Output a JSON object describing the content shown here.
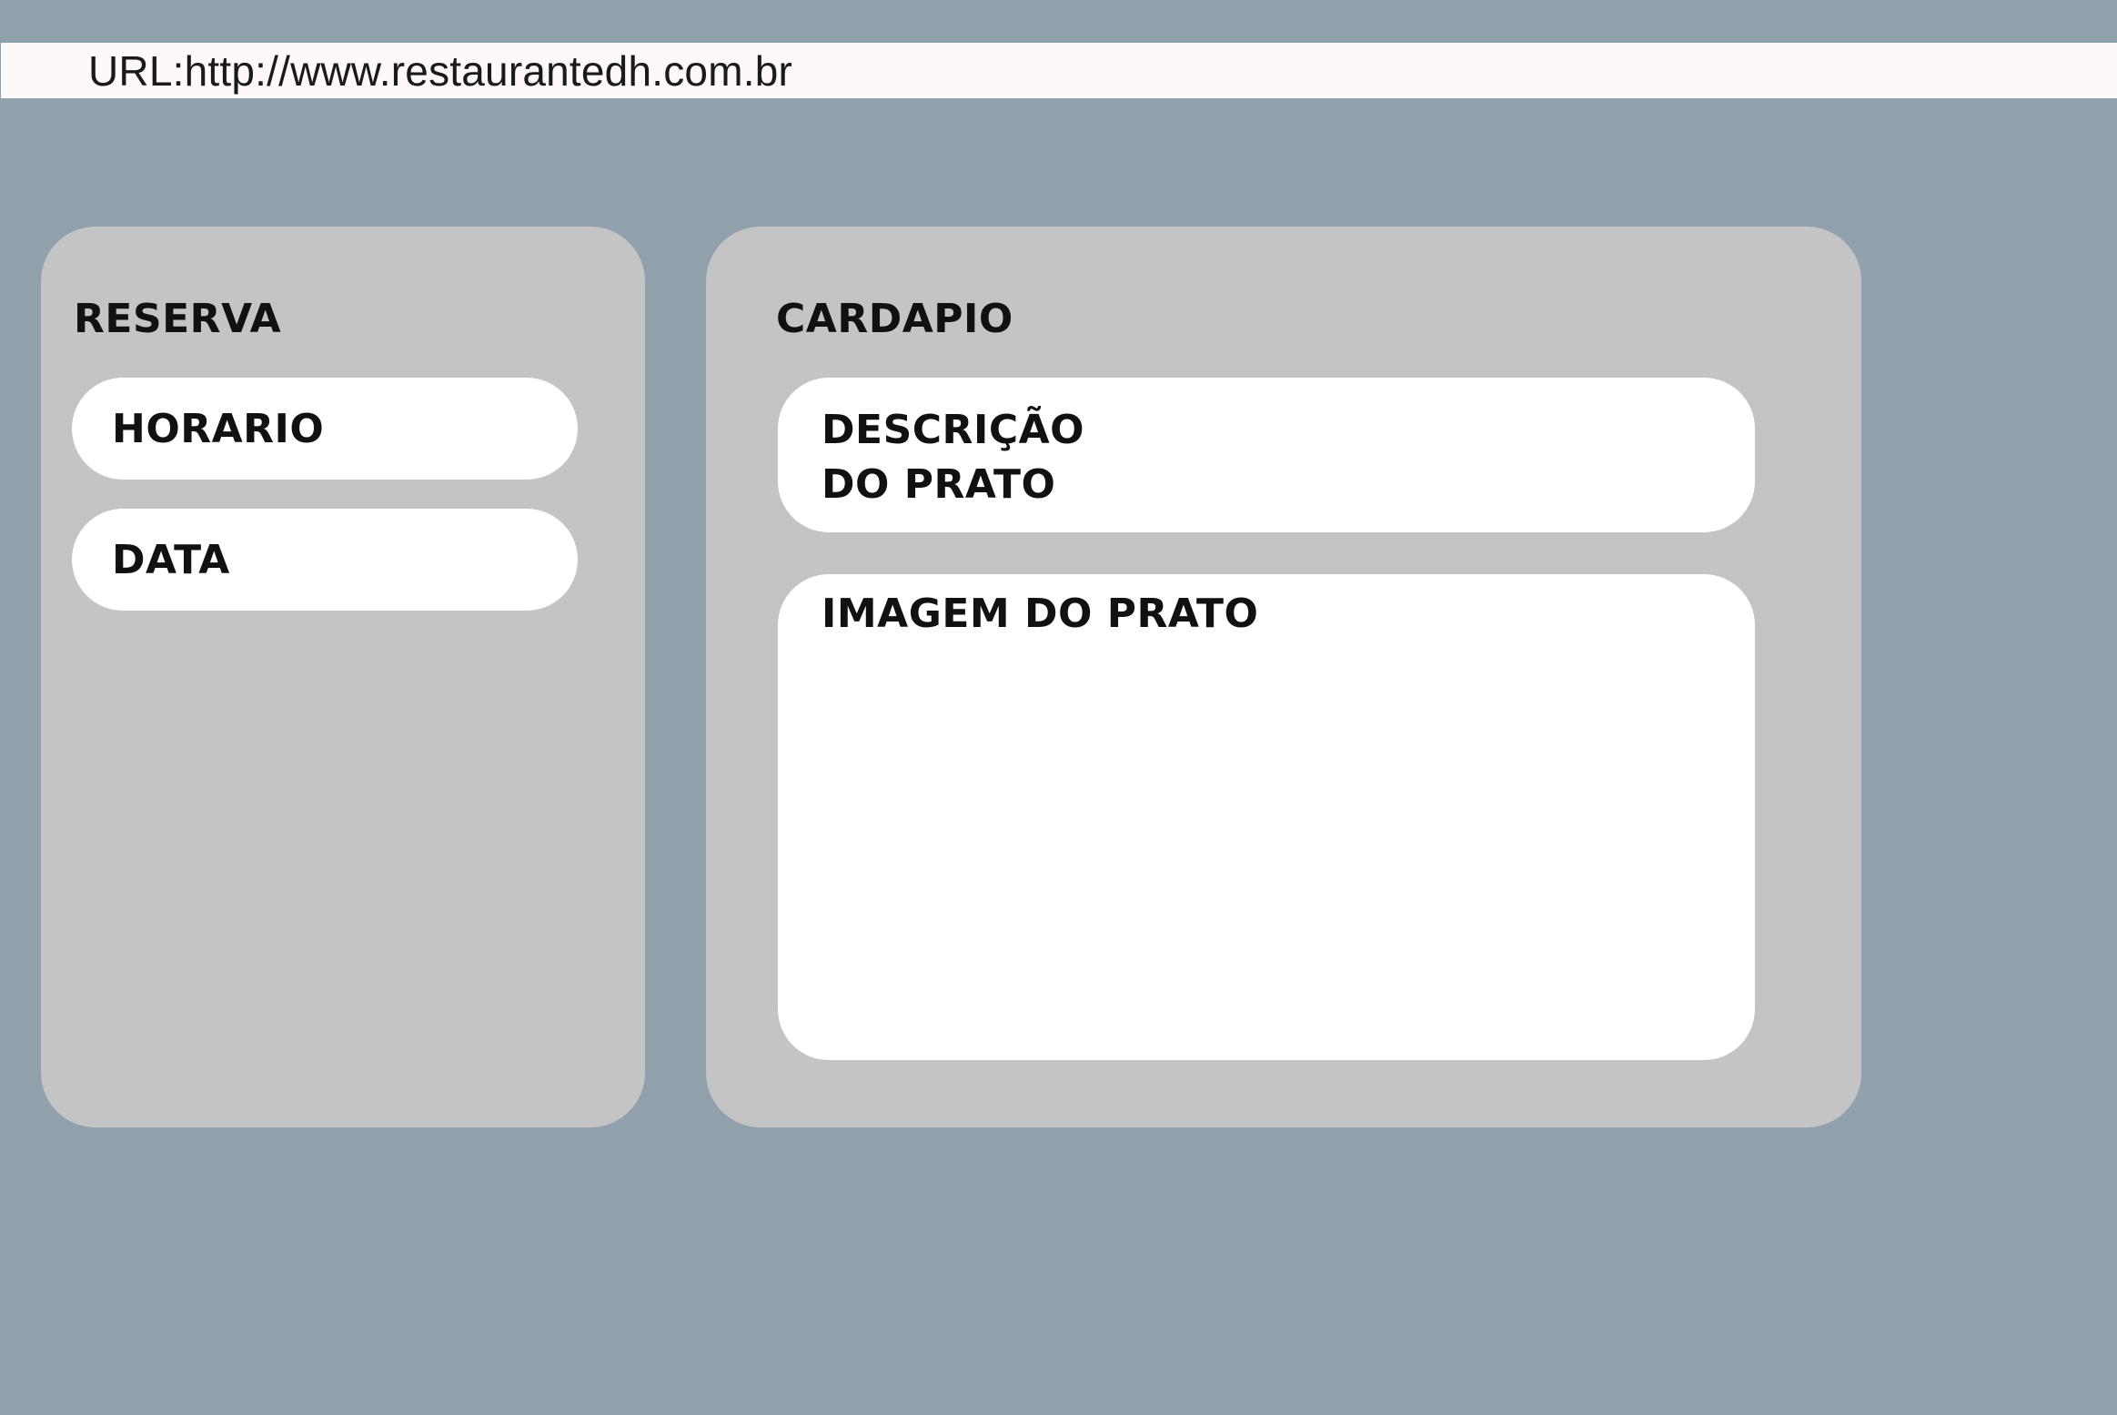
{
  "url_bar": {
    "text": "URL:http://www.restaurantedh.com.br"
  },
  "reserva": {
    "title": "RESERVA",
    "horario_label": "HORARIO",
    "data_label": "DATA"
  },
  "cardapio": {
    "title": "CARDAPIO",
    "descricao_line1": "DESCRIÇÃO",
    "descricao_line2": "DO PRATO",
    "imagem_label": "IMAGEM DO PRATO"
  },
  "colors": {
    "background": "#90a1ab",
    "url_bar": "#fff8f8",
    "panel": "#c4c4c4",
    "field": "#ffffff",
    "text": "#111111"
  }
}
